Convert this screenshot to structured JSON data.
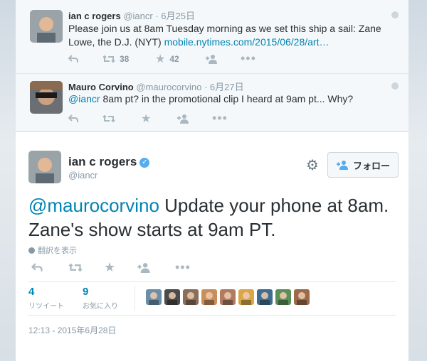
{
  "tweet1": {
    "name": "ian c rogers",
    "handle": "@iancr",
    "date": "· 6月25日",
    "text": "Please join us at 8am Tuesday morning as we set this ship a sail: Zane Lowe, the D.J. (NYT) ",
    "link": "mobile.nytimes.com/2015/06/28/art…",
    "retweets": "38",
    "favorites": "42"
  },
  "tweet2": {
    "name": "Mauro Corvino",
    "handle": "@maurocorvino",
    "date": "· 6月27日",
    "mention": "@iancr",
    "text": " 8am pt? in the promotional clip I heard at 9am pt... Why?"
  },
  "main": {
    "name": "ian c rogers",
    "handle": "@iancr",
    "follow_label": "フォロー",
    "mention": "@maurocorvino",
    "text": " Update your phone at 8am. Zane's show starts at 9am PT.",
    "translate": "翻訳を表示",
    "retweet_count": "4",
    "retweet_label": "リツイート",
    "fav_count": "9",
    "fav_label": "お気に入り",
    "timestamp": "12:13 - 2015年6月28日",
    "fav_avatar_colors": [
      "#6a8fa8",
      "#4b4b4b",
      "#8a6e5a",
      "#c98f5b",
      "#b07b62",
      "#d9a74a",
      "#3f6d8f",
      "#5a8f5a",
      "#9a6b4b"
    ]
  }
}
